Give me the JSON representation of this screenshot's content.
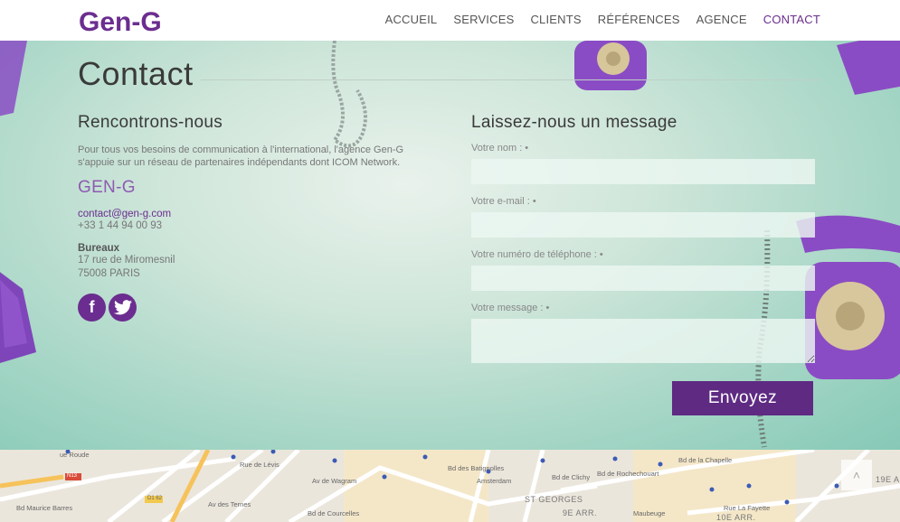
{
  "brand": {
    "logo_text": "Gen-G",
    "color": "#6b2d8f"
  },
  "nav": {
    "items": [
      {
        "label": "ACCUEIL",
        "active": false
      },
      {
        "label": "SERVICES",
        "active": false
      },
      {
        "label": "CLIENTS",
        "active": false
      },
      {
        "label": "RÉFÉRENCES",
        "active": false
      },
      {
        "label": "AGENCE",
        "active": false
      },
      {
        "label": "CONTACT",
        "active": true
      }
    ]
  },
  "page": {
    "title": "Contact"
  },
  "meet": {
    "heading": "Rencontrons-nous",
    "intro": "Pour tous vos besoins de communication à l'international, l'agence Gen-G s'appuie sur un réseau de partenaires indépendants dont ICOM Network.",
    "company": "GEN-G",
    "email": "contact@gen-g.com",
    "phone": "+33 1 44 94 00 93",
    "office_label": "Bureaux",
    "address_line1": "17 rue de Miromesnil",
    "address_line2": "75008 PARIS",
    "social": [
      {
        "name": "facebook",
        "glyph": "f"
      },
      {
        "name": "twitter",
        "glyph": "t"
      }
    ]
  },
  "form": {
    "heading": "Laissez-nous un message",
    "name_label": "Votre nom : •",
    "email_label": "Votre e-mail : •",
    "phone_label": "Votre numéro de téléphone : •",
    "message_label": "Votre message : •",
    "submit_label": "Envoyez"
  },
  "map": {
    "labels": [
      "ue Roude",
      "N13",
      "Bd Maurice Barres",
      "Av des Ternes",
      "D1 62",
      "Bd de Courcelles",
      "Av de Wagram",
      "Rue de Lévis",
      "Bd des Batignolles",
      "ST GEORGES",
      "9E ARR.",
      "Bd de Clichy",
      "Bd de Rochechouart",
      "Bd de la Chapelle",
      "Rue La Fayette",
      "19E A",
      "10E ARR.",
      "Maubeuge",
      "Amsterdam"
    ],
    "scroll_top_glyph": "˄"
  },
  "colors": {
    "accent": "#6b2d8f",
    "button": "#5e2a82",
    "link": "#8e5bb0"
  }
}
